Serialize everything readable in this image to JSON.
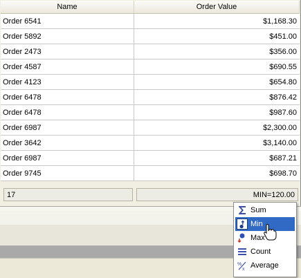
{
  "grid": {
    "columns": [
      "Name",
      "Order Value"
    ],
    "rows": [
      [
        "Order 6541",
        "$1,168.30"
      ],
      [
        "Order 5892",
        "$451.00"
      ],
      [
        "Order 2473",
        "$356.00"
      ],
      [
        "Order 4587",
        "$690.55"
      ],
      [
        "Order 4123",
        "$654.80"
      ],
      [
        "Order 6478",
        "$876.42"
      ],
      [
        "Order 6478",
        "$987.60"
      ],
      [
        "Order 6987",
        "$2,300.00"
      ],
      [
        "Order 3642",
        "$3,140.00"
      ],
      [
        "Order 6987",
        "$687.21"
      ],
      [
        "Order 9745",
        "$698.70"
      ]
    ],
    "footer": {
      "count": "17",
      "aggregate": "MIN=120.00"
    }
  },
  "summary_menu": {
    "items": [
      {
        "label": "Sum",
        "icon": "sigma-icon"
      },
      {
        "label": "Min",
        "icon": "min-icon",
        "selected": true
      },
      {
        "label": "Max",
        "icon": "max-icon"
      },
      {
        "label": "Count",
        "icon": "count-icon"
      },
      {
        "label": "Average",
        "icon": "average-icon"
      }
    ]
  },
  "colors": {
    "selection": "#316ac5",
    "grid_line": "#c8c8c8"
  }
}
